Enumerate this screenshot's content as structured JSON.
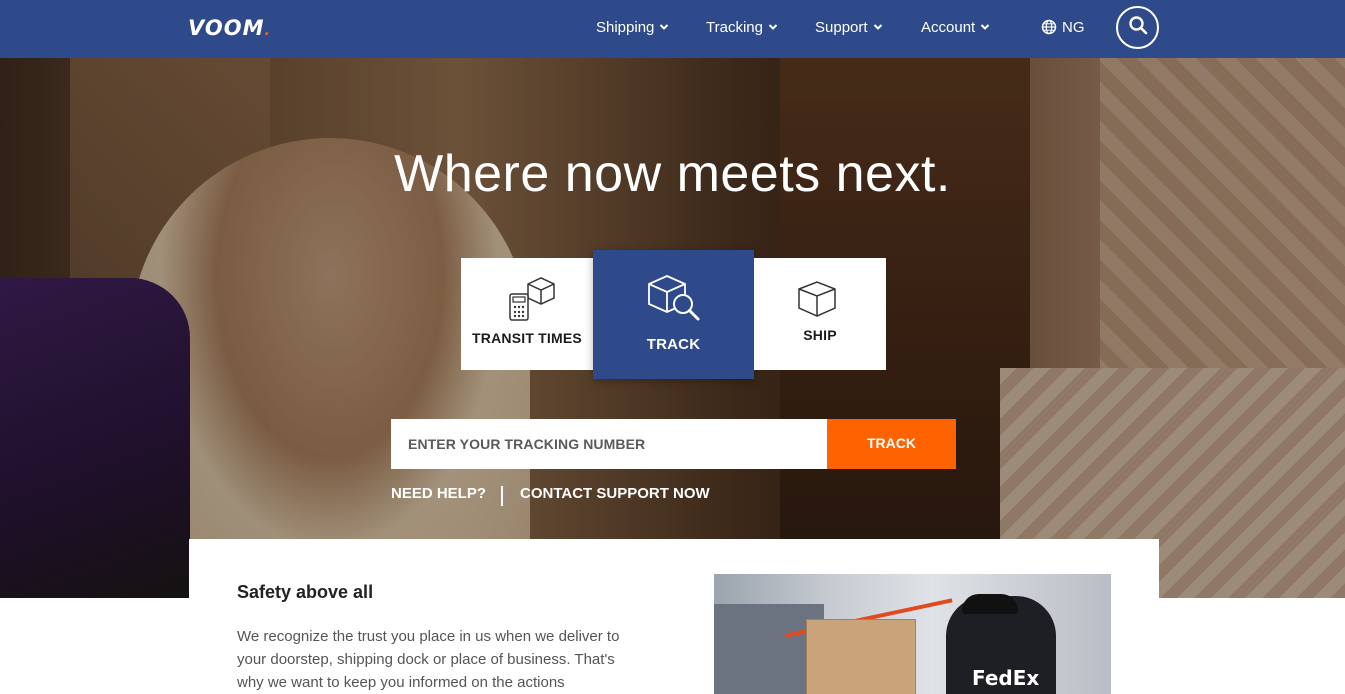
{
  "header": {
    "logo_text": "VOOM",
    "nav": [
      {
        "label": "Shipping"
      },
      {
        "label": "Tracking"
      },
      {
        "label": "Support"
      },
      {
        "label": "Account"
      }
    ],
    "locale": "NG",
    "search_icon": "search-icon"
  },
  "hero": {
    "headline": "Where now meets next.",
    "actions": [
      {
        "label": "TRANSIT TIMES",
        "icon": "calculator-box-icon",
        "active": false
      },
      {
        "label": "TRACK",
        "icon": "box-magnifier-icon",
        "active": true
      },
      {
        "label": "SHIP",
        "icon": "box-icon",
        "active": false
      }
    ],
    "tracking": {
      "placeholder": "ENTER YOUR TRACKING NUMBER",
      "button_label": "TRACK"
    },
    "help": {
      "prompt": "NEED HELP?",
      "link": "CONTACT SUPPORT NOW"
    }
  },
  "content": {
    "title": "Safety above all",
    "body": "We recognize the trust you place in us when we deliver to your doorstep, shipping dock or place of business. That's why we want to keep you informed on the actions",
    "photo_brand": "FedEx"
  },
  "colors": {
    "header_bg": "#2e4a8b",
    "accent": "#ff6200",
    "active_card": "#2e4a8b"
  }
}
